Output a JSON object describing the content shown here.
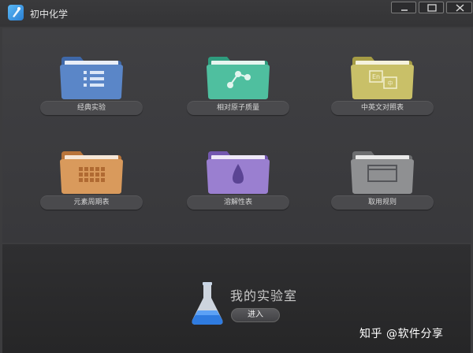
{
  "window": {
    "title": "初中化学",
    "controls": [
      "minimize",
      "maximize",
      "close"
    ]
  },
  "modules": [
    {
      "label": "经典实验",
      "icon": "list-icon",
      "color": "#5a86c8"
    },
    {
      "label": "相对原子质量",
      "icon": "molecule-icon",
      "color": "#4fbf9f"
    },
    {
      "label": "中英文对照表",
      "icon": "translate-icon",
      "color": "#c9c068"
    },
    {
      "label": "元素周期表",
      "icon": "grid-icon",
      "color": "#d99a5c"
    },
    {
      "label": "溶解性表",
      "icon": "drop-icon",
      "color": "#9a7fd0"
    },
    {
      "label": "取用规则",
      "icon": "window-icon",
      "color": "#8f9092"
    }
  ],
  "lab": {
    "title": "我的实验室",
    "enter_label": "进入"
  },
  "watermark": "知乎 @软件分享"
}
